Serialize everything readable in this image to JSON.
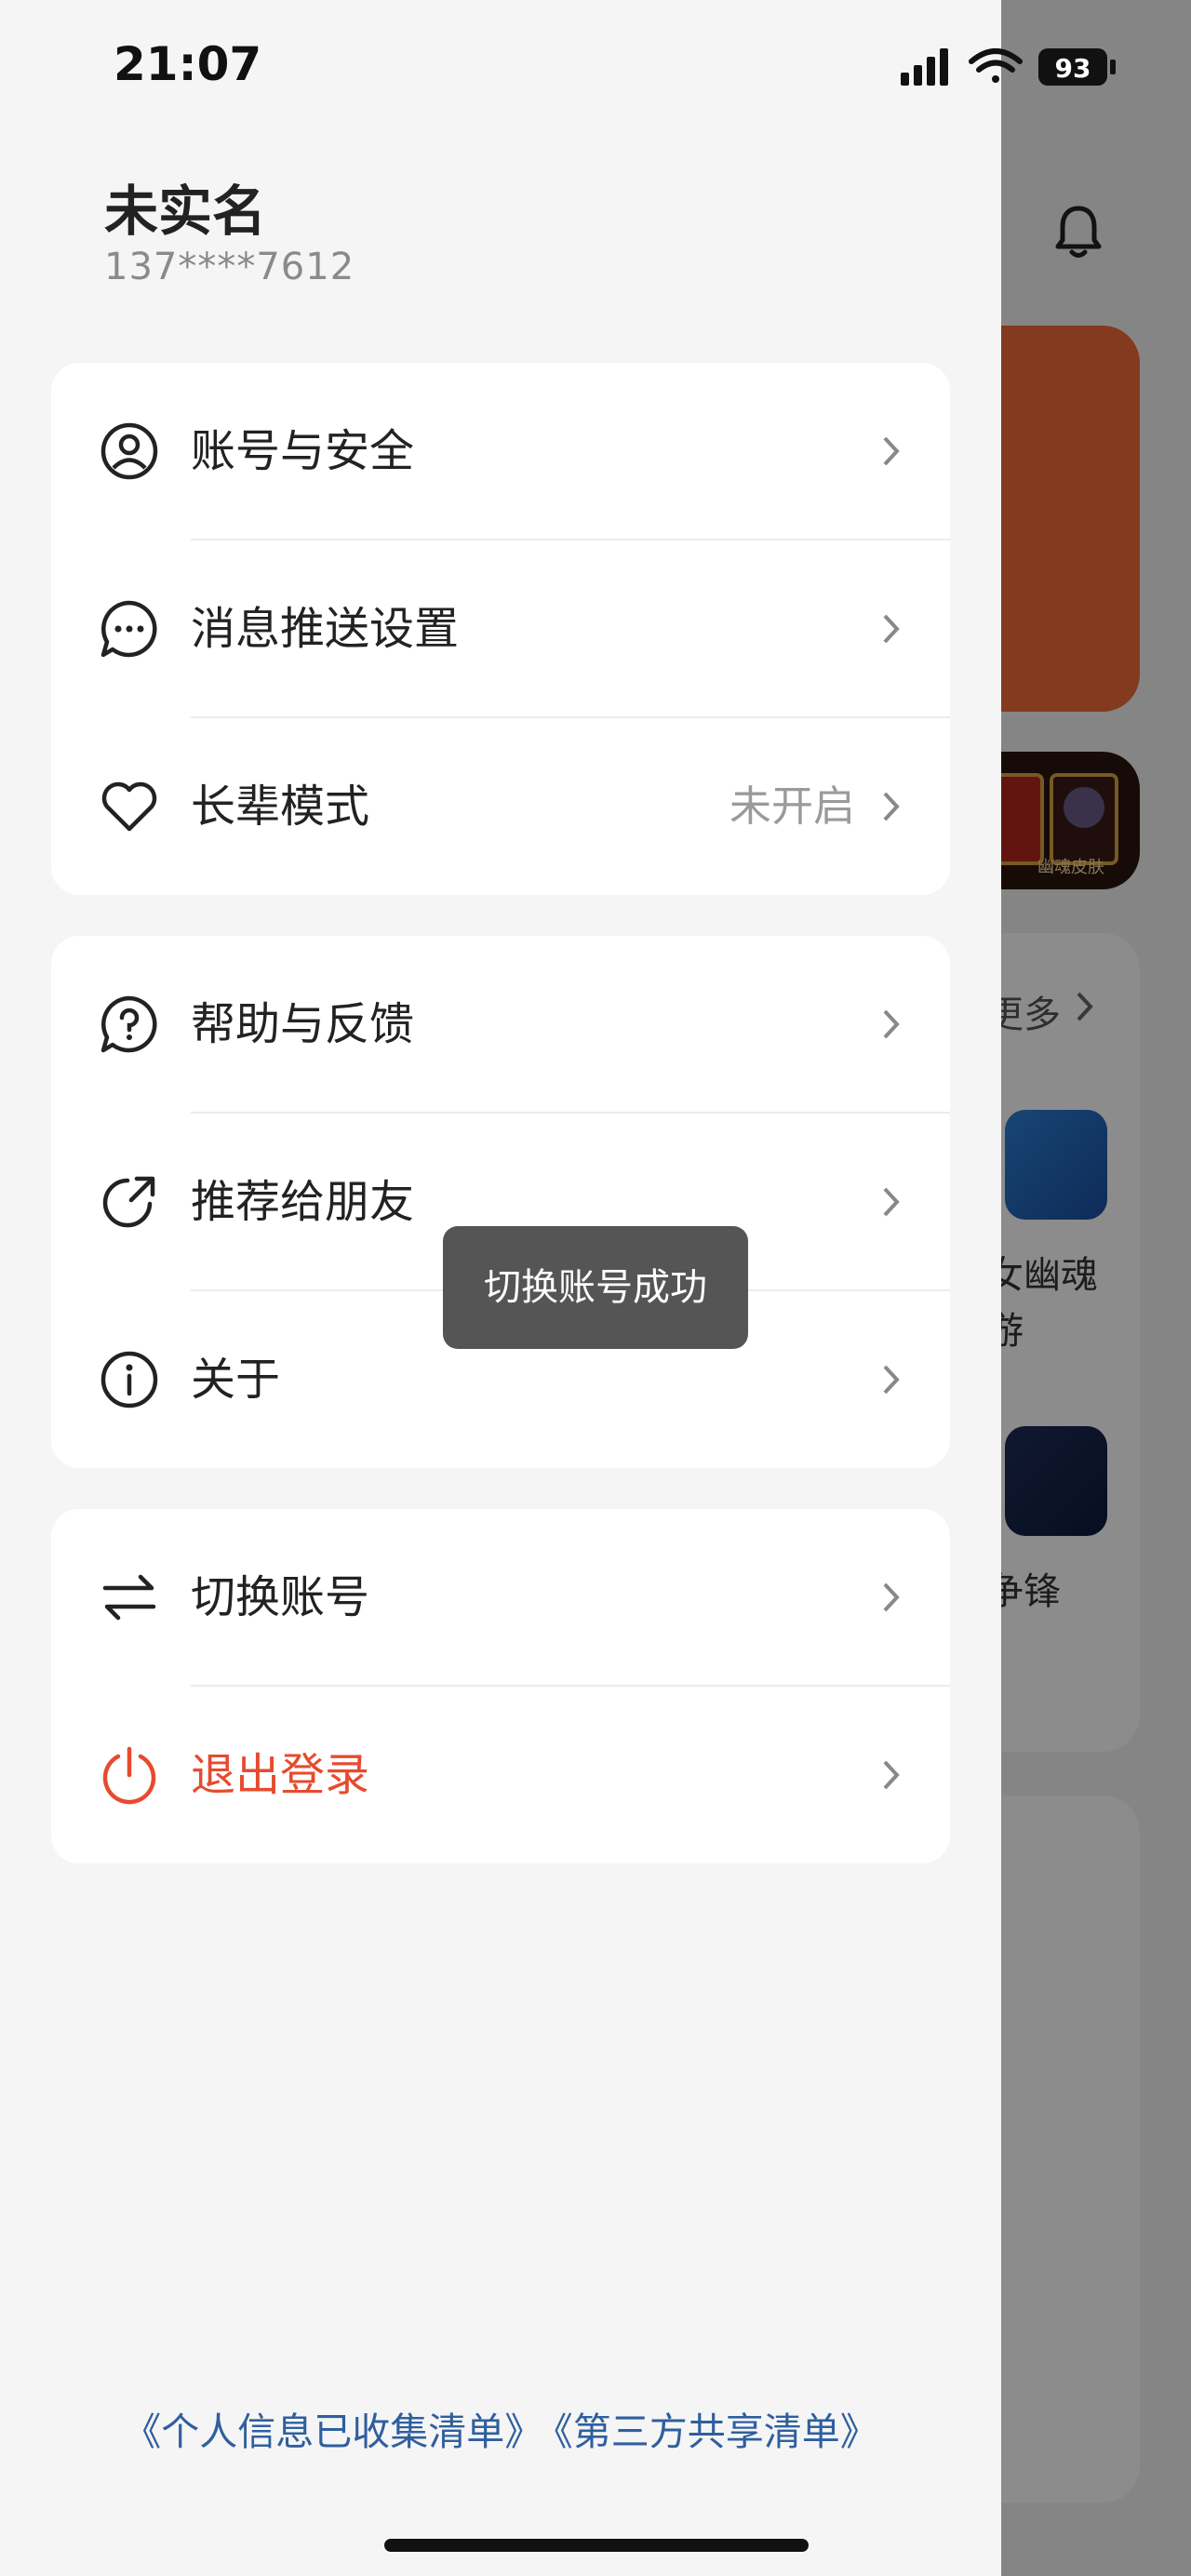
{
  "status_bar": {
    "time": "21:07",
    "battery": "93"
  },
  "user": {
    "name": "未实名",
    "phone": "137****7612"
  },
  "groups": [
    [
      {
        "id": "account-security",
        "label": "账号与安全",
        "value": ""
      },
      {
        "id": "push-settings",
        "label": "消息推送设置",
        "value": ""
      },
      {
        "id": "elder-mode",
        "label": "长辈模式",
        "value": "未开启"
      }
    ],
    [
      {
        "id": "help-feedback",
        "label": "帮助与反馈",
        "value": ""
      },
      {
        "id": "recommend-friends",
        "label": "推荐给朋友",
        "value": ""
      },
      {
        "id": "about",
        "label": "关于",
        "value": ""
      }
    ],
    [
      {
        "id": "switch-account",
        "label": "切换账号",
        "value": ""
      },
      {
        "id": "logout",
        "label": "退出登录",
        "value": ""
      }
    ]
  ],
  "toast": "切换账号成功",
  "legal": {
    "personal_info_list": "《个人信息已收集清单》",
    "third_party_list": "《第三方共享清单》"
  },
  "background_app": {
    "more_label": "更多",
    "game1_name_line1": "女幽魂",
    "game1_name_line2": "游",
    "game2_name": "争锋",
    "banner_caption": "幽魂皮肤"
  },
  "colors": {
    "danger": "#e64b2e",
    "link": "#2f5f9e",
    "accent_bg": "#ef6a3a"
  }
}
